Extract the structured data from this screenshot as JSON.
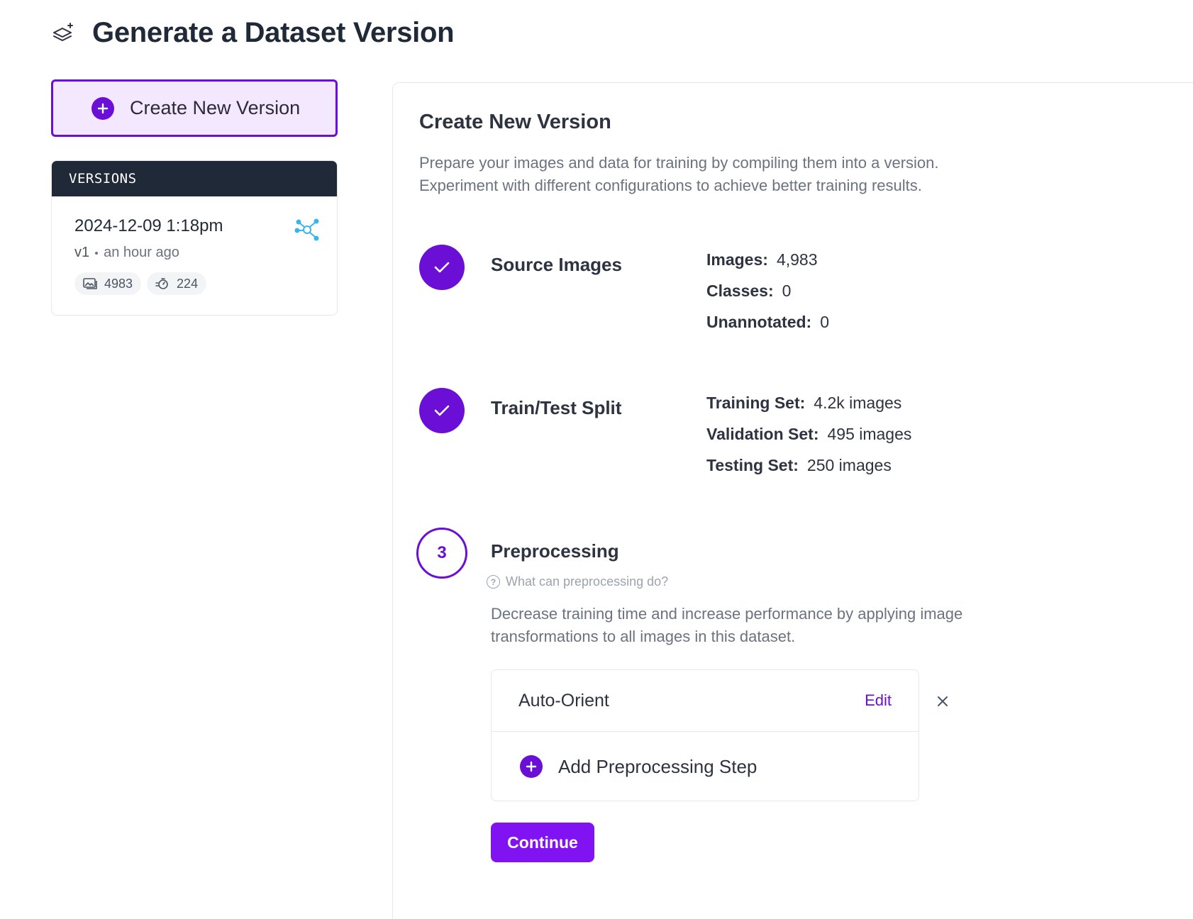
{
  "page": {
    "title": "Generate a Dataset Version"
  },
  "sidebar": {
    "create_button_label": "Create New Version",
    "versions_header": "VERSIONS",
    "versions": [
      {
        "date": "2024-12-09 1:18pm",
        "version": "v1",
        "age": "an hour ago",
        "image_count": "4983",
        "size_label": "224"
      }
    ]
  },
  "main": {
    "title": "Create New Version",
    "description": "Prepare your images and data for training by compiling them into a version. Experiment with different configurations to achieve better training results.",
    "steps": [
      {
        "title": "Source Images",
        "status": "complete",
        "stats": [
          {
            "label": "Images:",
            "value": "4,983"
          },
          {
            "label": "Classes:",
            "value": "0"
          },
          {
            "label": "Unannotated:",
            "value": "0"
          }
        ]
      },
      {
        "title": "Train/Test Split",
        "status": "complete",
        "stats": [
          {
            "label": "Training Set:",
            "value": "4.2k images"
          },
          {
            "label": "Validation Set:",
            "value": "495 images"
          },
          {
            "label": "Testing Set:",
            "value": "250 images"
          }
        ]
      },
      {
        "number": "3",
        "title": "Preprocessing",
        "status": "active",
        "help_link": "What can preprocessing do?",
        "description": "Decrease training time and increase performance by applying image transformations to all images in this dataset.",
        "applied_steps": [
          {
            "label": "Auto-Orient",
            "edit_label": "Edit"
          }
        ],
        "add_step_label": "Add Preprocessing Step",
        "continue_label": "Continue"
      }
    ]
  },
  "colors": {
    "accent": "#6b0fd6",
    "accent_light": "#f3e8ff",
    "continue": "#8112f2",
    "header_dark": "#1f2937",
    "graph_icon": "#38b6e8"
  },
  "icons": {
    "title": "layers-sparkle-icon",
    "create": "plus-circle-icon",
    "version_type": "graph-nodes-icon",
    "images": "image-icon",
    "size": "resize-timer-icon",
    "step_done": "check-icon",
    "help": "question-circle-icon",
    "remove": "close-icon"
  }
}
